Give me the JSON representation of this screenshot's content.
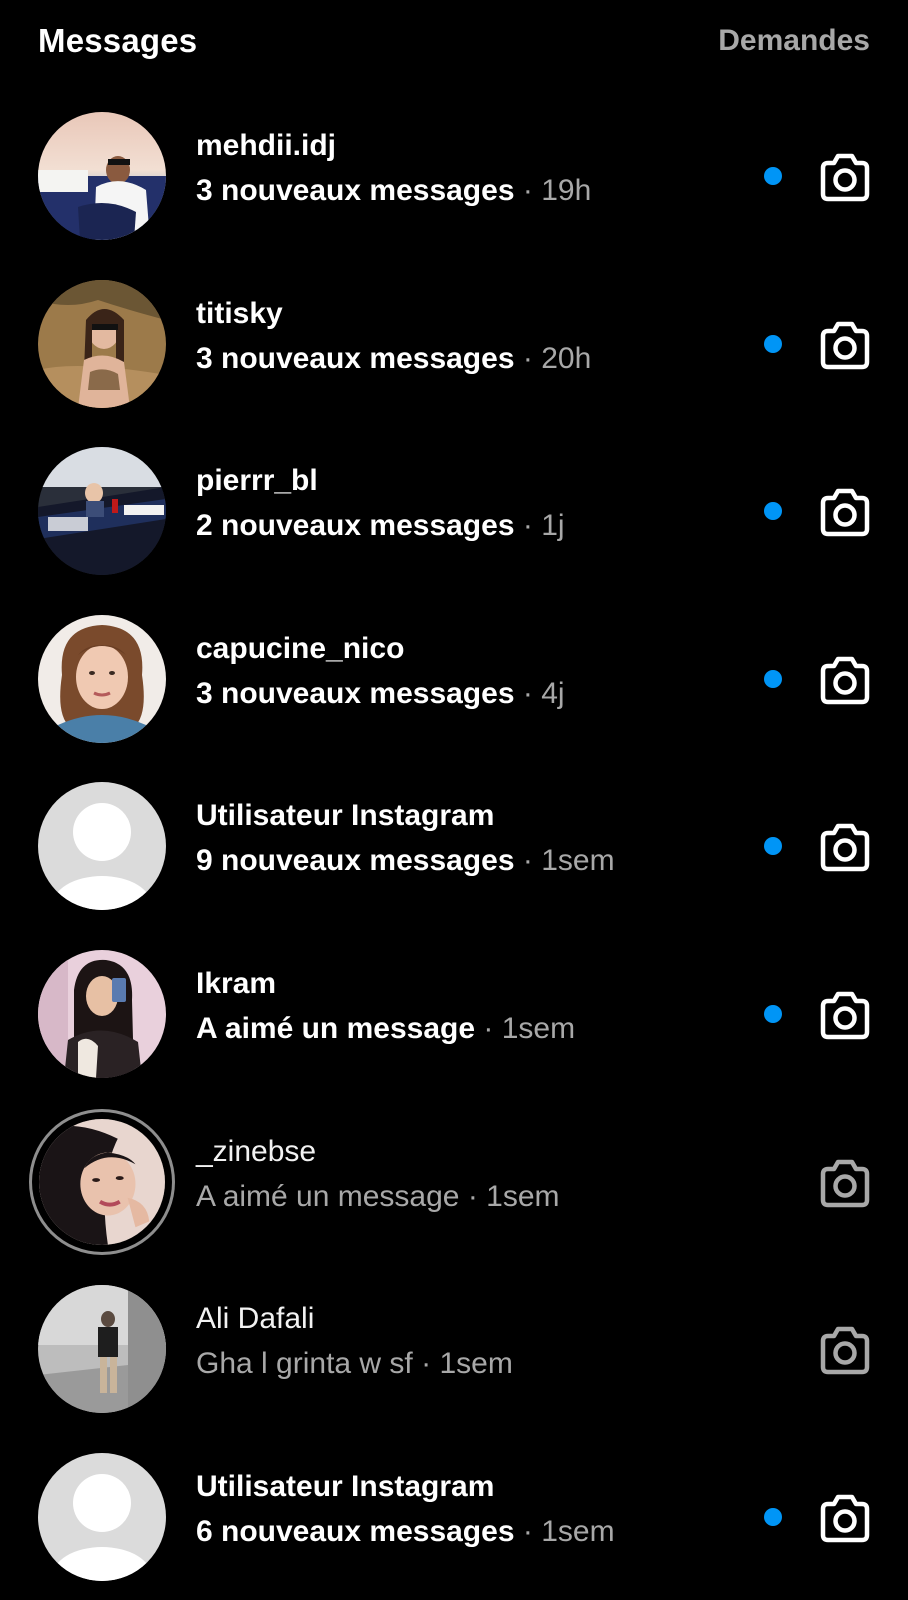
{
  "header": {
    "title": "Messages",
    "requests_label": "Demandes"
  },
  "colors": {
    "background": "#000000",
    "unread_dot": "#0095f6",
    "secondary_text": "#a8a8a8"
  },
  "icons": {
    "camera": "camera-icon",
    "avatar_placeholder": "default-avatar-icon"
  },
  "conversations": [
    {
      "name": "mehdii.idj",
      "message": "3 nouveaux messages",
      "separator": "·",
      "time": "19h",
      "unread": true
    },
    {
      "name": "titisky",
      "message": "3 nouveaux messages",
      "separator": "·",
      "time": "20h",
      "unread": true
    },
    {
      "name": "pierrr_bl",
      "message": "2 nouveaux messages",
      "separator": "·",
      "time": "1j",
      "unread": true
    },
    {
      "name": "capucine_nico",
      "message": "3 nouveaux messages",
      "separator": "·",
      "time": "4j",
      "unread": true
    },
    {
      "name": "Utilisateur Instagram",
      "message": "9 nouveaux messages",
      "separator": "·",
      "time": "1sem",
      "unread": true
    },
    {
      "name": "Ikram",
      "message": "A aimé un message",
      "separator": "·",
      "time": "1sem",
      "unread": true
    },
    {
      "name": "_zinebse",
      "message": "A aimé un message",
      "separator": "·",
      "time": "1sem",
      "unread": false
    },
    {
      "name": "Ali Dafali",
      "message": "Gha l grinta w sf",
      "separator": "·",
      "time": "1sem",
      "unread": false
    },
    {
      "name": "Utilisateur Instagram",
      "message": "6 nouveaux messages",
      "separator": "·",
      "time": "1sem",
      "unread": true
    }
  ]
}
